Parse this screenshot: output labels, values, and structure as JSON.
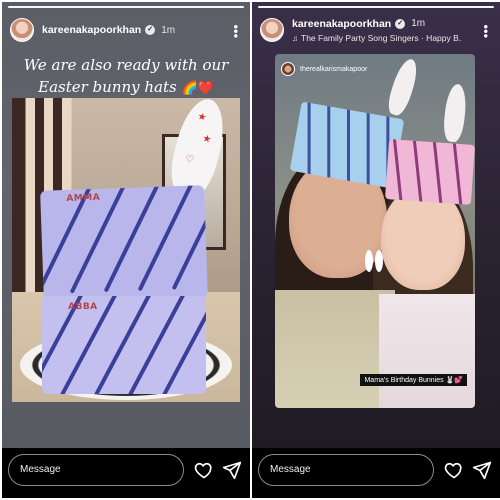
{
  "stories": [
    {
      "username": "kareenakapoorkhan",
      "time": "1m",
      "caption_line1": "We are also ready with our",
      "caption_line2": "Easter bunny hats",
      "caption_emoji": "🌈❤️",
      "hat_top_label": "AMMA",
      "hat_bottom_label": "ABBA",
      "message_placeholder": "Message"
    },
    {
      "username": "kareenakapoorkhan",
      "time": "1m",
      "music": "The Family Party Song Singers · Happy B...",
      "reposted_from": "therealkarismakapoor",
      "sticker_text": "Mama's Birthday Bunnies 🐰💕",
      "message_placeholder": "Message"
    }
  ],
  "icons": {
    "verified": "verified-badge-icon",
    "more": "more-options-icon",
    "heart": "heart-icon",
    "send": "send-icon",
    "music": "music-note-icon"
  },
  "colors": {
    "background": "#000000",
    "text": "#ffffff",
    "input_border": "#8c8c8c"
  }
}
